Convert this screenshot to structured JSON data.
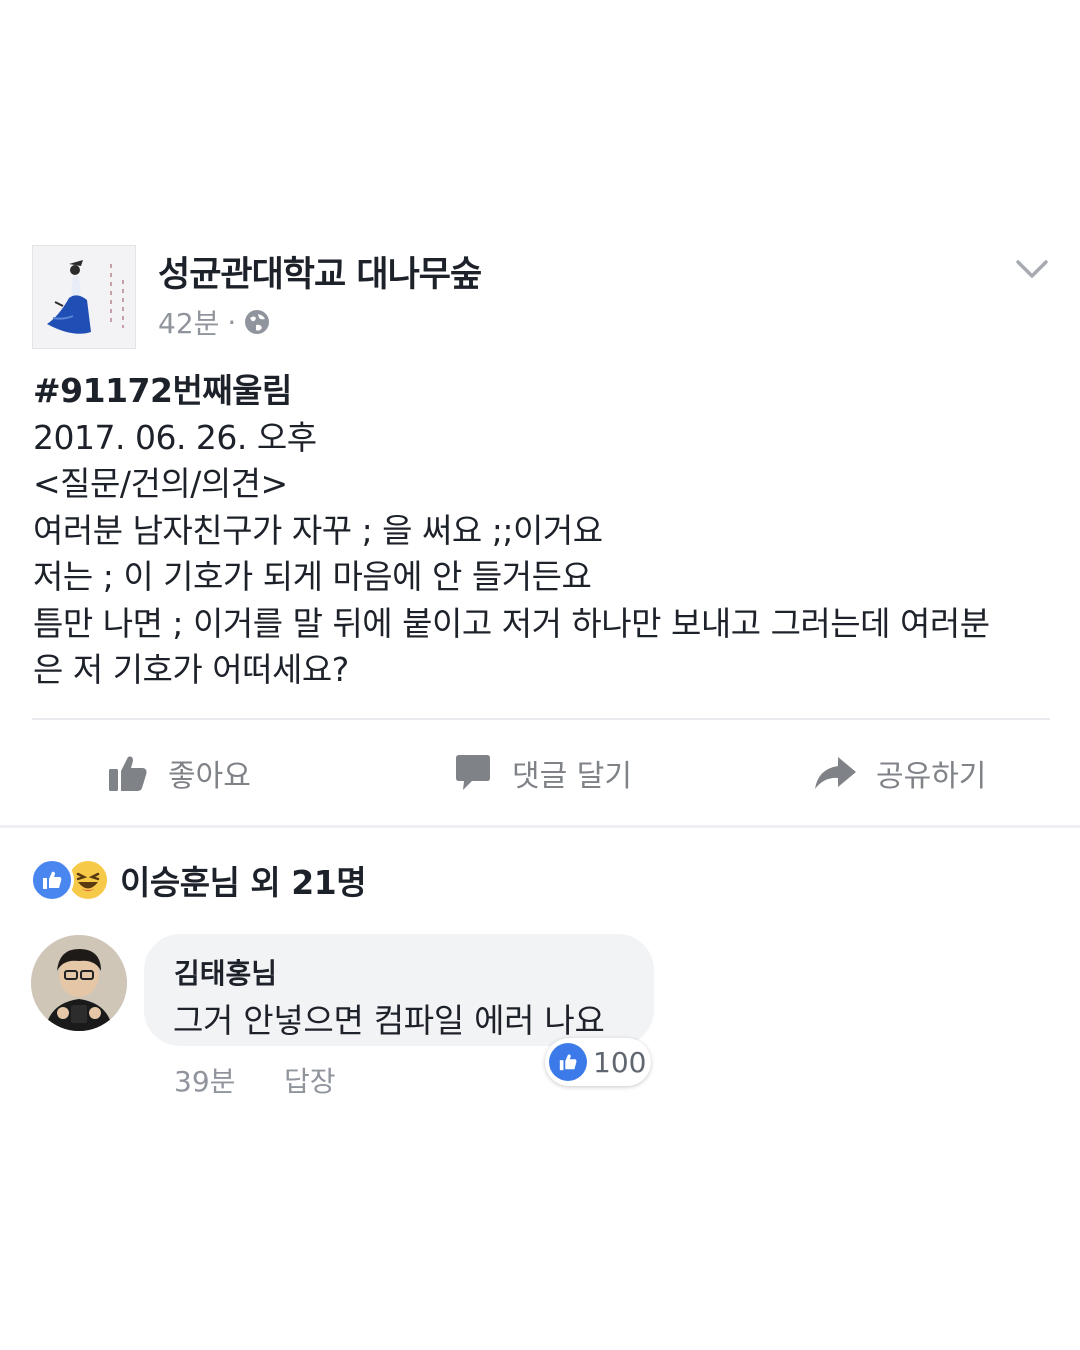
{
  "post": {
    "page_name": "성균관대학교 대나무숲",
    "time": "42분",
    "separator": "·",
    "privacy_icon": "globe-icon",
    "lines": [
      "#91172번째울림",
      "2017. 06. 26. 오후",
      "<질문/건의/의견>",
      "여러분 남자친구가 자꾸 ; 을 써요 ;;이거요",
      "저는 ; 이 기호가 되게 마음에 안 들거든요",
      "틈만 나면 ; 이거를 말 뒤에 붙이고 저거 하나만 보내고 그러는데 여러분",
      "은 저 기호가 어떠세요?"
    ]
  },
  "actions": {
    "like_label": "좋아요",
    "comment_label": "댓글 달기",
    "share_label": "공유하기"
  },
  "reactions": {
    "summary": "이승훈님 외 21명",
    "icons": [
      "like-icon",
      "haha-icon"
    ]
  },
  "comment": {
    "author": "김태홍님",
    "text": "그거 안넣으면 컴파일 에러 나요",
    "time": "39분",
    "reply_label": "답장",
    "like_count": "100"
  },
  "colors": {
    "accent": "#4a86f0",
    "text": "#1d2129",
    "muted": "#90949c",
    "bubble": "#f2f3f5"
  }
}
